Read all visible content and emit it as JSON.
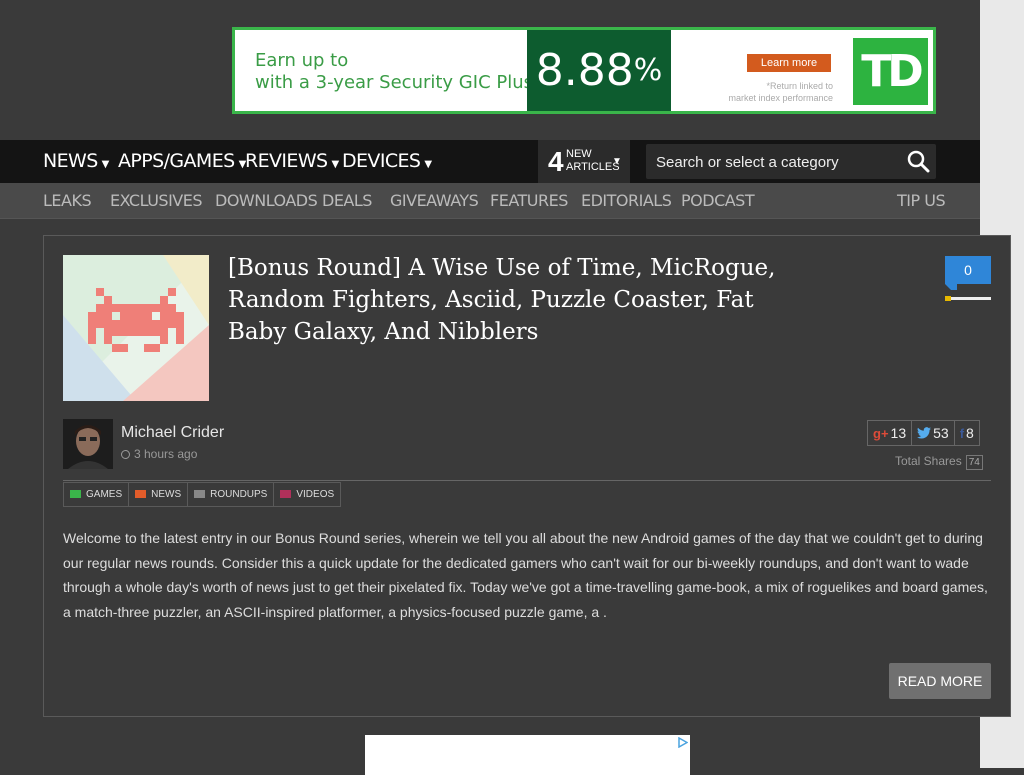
{
  "ad": {
    "line1": "Earn up to",
    "line2": "with a 3-year Security GIC Plus.*",
    "rate": "8.88",
    "rate_pct": "%",
    "learn_more": "Learn more",
    "note_line1": "*Return linked to",
    "note_line2": "market index performance",
    "logo": "TD"
  },
  "nav": {
    "items": [
      {
        "label": "NEWS"
      },
      {
        "label": "APPS/GAMES"
      },
      {
        "label": "REVIEWS"
      },
      {
        "label": "DEVICES"
      }
    ],
    "new_articles_count": "4",
    "new_articles_line1": "NEW",
    "new_articles_line2": "ARTICLES",
    "search_placeholder": "Search or select a category"
  },
  "subnav": {
    "items": [
      {
        "label": "LEAKS"
      },
      {
        "label": "EXCLUSIVES"
      },
      {
        "label": "DOWNLOADS"
      },
      {
        "label": "DEALS"
      },
      {
        "label": "GIVEAWAYS"
      },
      {
        "label": "FEATURES"
      },
      {
        "label": "EDITORIALS"
      },
      {
        "label": "PODCAST"
      }
    ],
    "tip": "TIP US"
  },
  "article": {
    "title": "[Bonus Round] A Wise Use of Time, MicRogue, Random Fighters, Asciid, Puzzle Coaster, Fat Baby Galaxy, And Nibblers",
    "comments": "0",
    "author": "Michael Crider",
    "time": "3 hours ago",
    "shares": {
      "gplus": "13",
      "twitter": "53",
      "facebook": "8"
    },
    "gplus_icon_text": "g+",
    "facebook_icon_text": "f",
    "total_label": "Total Shares",
    "total": "74",
    "tags": [
      {
        "label": "GAMES",
        "color": "#3ab54a"
      },
      {
        "label": "NEWS",
        "color": "#e25c2a"
      },
      {
        "label": "ROUNDUPS",
        "color": "#888888"
      },
      {
        "label": "VIDEOS",
        "color": "#b0305a"
      }
    ],
    "excerpt": "Welcome to the latest entry in our Bonus Round series, wherein we tell you all about the new Android games of the day that we couldn't get to during our regular news rounds. Consider this a quick update for the dedicated gamers who can't wait for our bi-weekly roundups, and don't want to wade through a whole day's worth of news just to get their pixelated fix. Today we've got a time-travelling game-book, a mix of roguelikes and board games, a match-three puzzler, an ASCII-inspired platformer, a physics-focused puzzle game, a .",
    "read_more": "READ MORE"
  },
  "colors": {
    "accent_blue": "#2f86d8",
    "td_green": "#2db340"
  }
}
